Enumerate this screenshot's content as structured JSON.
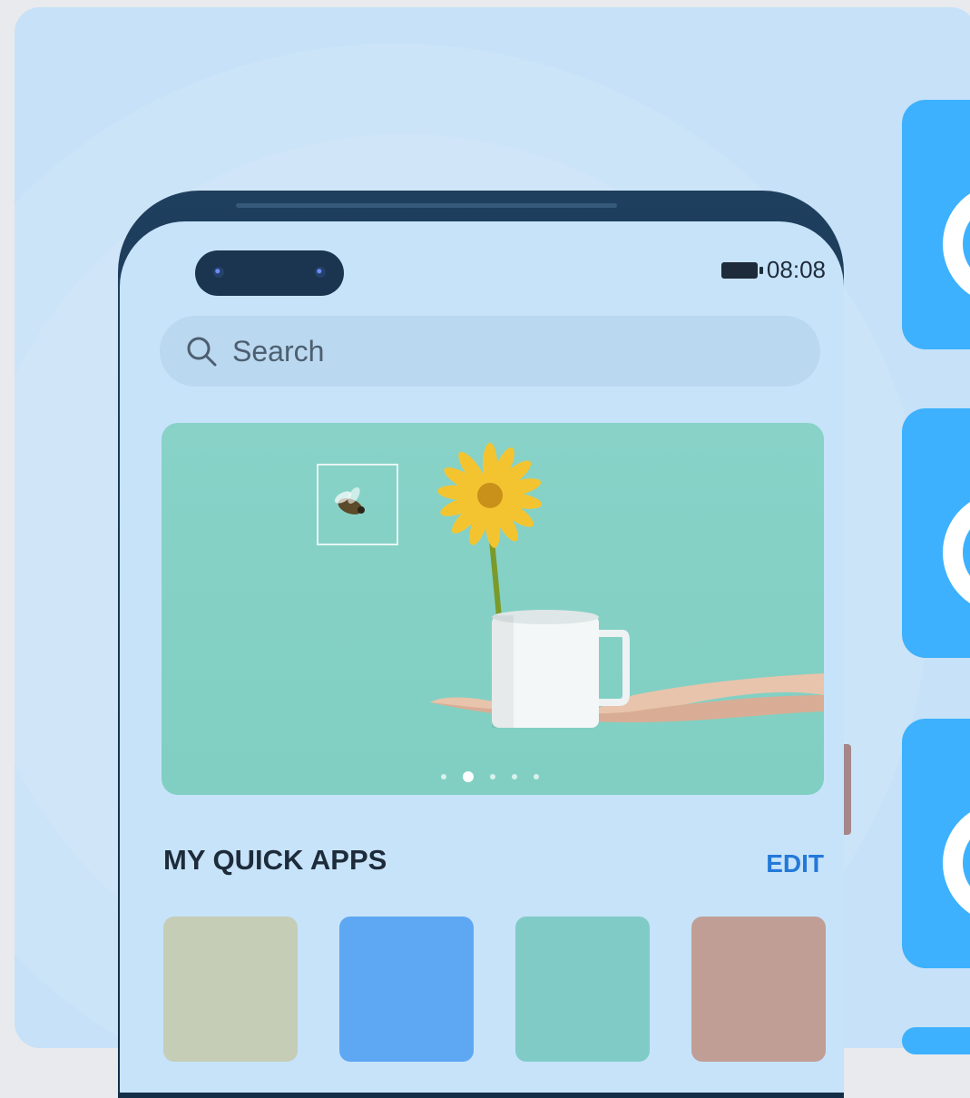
{
  "status_bar": {
    "time": "08:08",
    "battery_icon": "battery-icon"
  },
  "search": {
    "placeholder": "Search",
    "icon": "search-icon"
  },
  "banner": {
    "page_count": 5,
    "active_page": 2,
    "image_subject": "flower-in-mug-with-bee"
  },
  "quick_apps": {
    "title": "MY QUICK APPS",
    "edit_label": "EDIT",
    "tile_colors": [
      "#c6cdb6",
      "#5ea7f2",
      "#80cbc6",
      "#c09e95"
    ]
  },
  "colors": {
    "background": "#c6e1f8",
    "accent": "#2479d8",
    "side_card": "#3db1fd"
  }
}
